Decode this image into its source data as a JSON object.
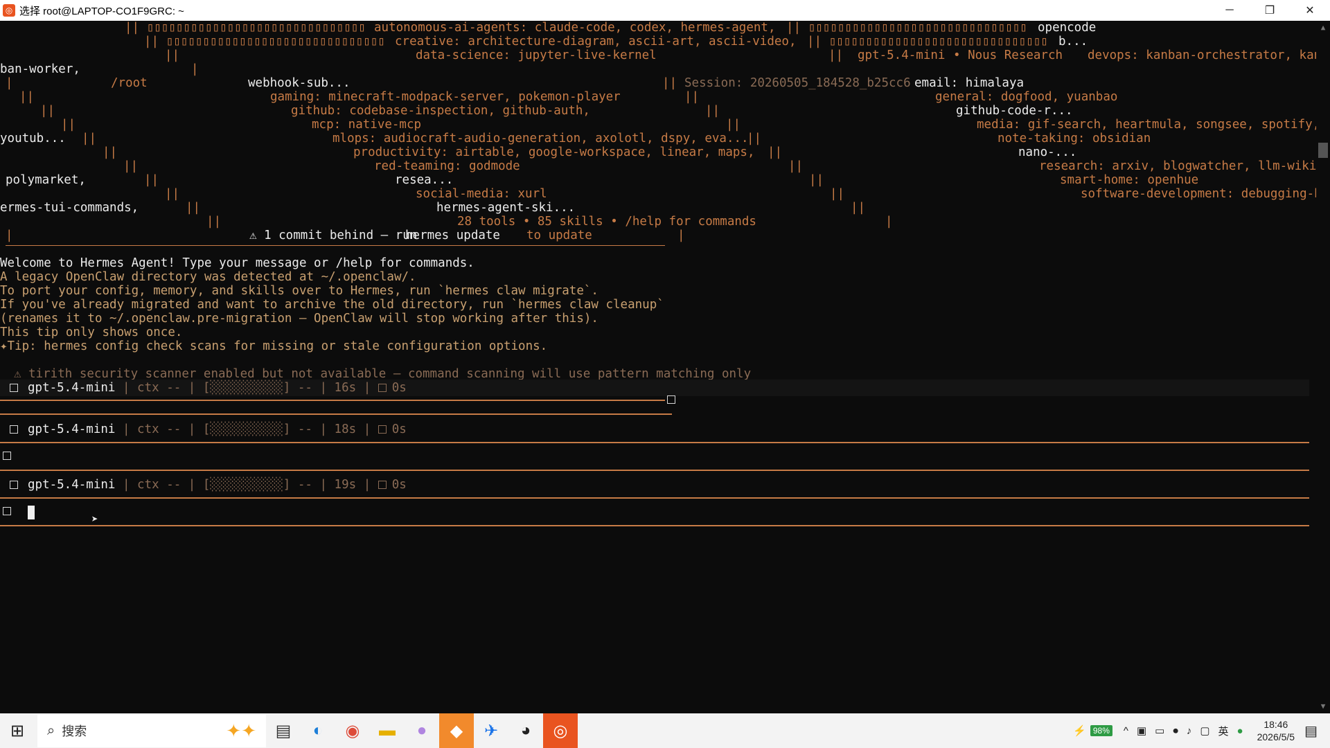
{
  "window": {
    "title": "选择 root@LAPTOP-CO1F9GRC: ~"
  },
  "banner": {
    "line1_skills": "autonomous-ai-agents: claude-code, codex, hermes-agent,",
    "line1_right": "opencode",
    "line2_skills": "creative: architecture-diagram, ascii-art, ascii-video,",
    "line2_right": "b...",
    "line3_skills": "data-science: jupyter-live-kernel",
    "line3_model": "gpt-5.4-mini",
    "line3_provider": "• Nous Research",
    "line3_devops": "devops: kanban-orchestrator, kan",
    "line4": "ban-worker,",
    "line5_cwd": "/root",
    "line5_mid": "webhook-sub...",
    "line5_session": "Session: 20260505_184528_b25cc6",
    "line5_email": "email: himalaya",
    "line6_gaming": "gaming: minecraft-modpack-server, pokemon-player",
    "line6_general": "general: dogfood, yuanbao",
    "line7_github": "github: codebase-inspection, github-auth,",
    "line7_right": "github-code-r...",
    "line8_mcp": "mcp: native-mcp",
    "line8_media": "media: gif-search, heartmula, songsee, spotify,",
    "line9_left": "youtub...",
    "line9_mlops": "mlops: audiocraft-audio-generation, axolotl, dspy, eva...",
    "line9_note": "note-taking: obsidian",
    "line10_prod": "productivity: airtable, google-workspace, linear, maps,",
    "line10_right": "nano-...",
    "line11_red": "red-teaming: godmode",
    "line11_research": "research: arxiv, blogwatcher, llm-wiki,",
    "line12_left": "polymarket,",
    "line12_mid": "resea...",
    "line12_smart": "smart-home: openhue",
    "line13_social": "social-media: xurl",
    "line13_soft": "software-development: debugging-h",
    "line14_left": "ermes-tui-commands,",
    "line14_mid": "hermes-agent-ski...",
    "line15_tools": "28 tools • 85 skills • /help for commands",
    "line16_warn": "⚠ 1 commit behind — run",
    "line16_cmd": "hermes update",
    "line16_tail": "to update"
  },
  "messages": {
    "welcome": "Welcome to Hermes Agent! Type your message or /help for commands.",
    "legacy1": "A legacy OpenClaw directory was detected at ~/.openclaw/.",
    "legacy2": "To port your config, memory, and skills over to Hermes, run `hermes claw migrate`.",
    "legacy3": "If you've already migrated and want to archive the old directory, run `hermes claw cleanup`",
    "legacy4": "(renames it to ~/.openclaw.pre-migration — OpenClaw will stop working after this).",
    "legacy5": "This tip only shows once.",
    "tip": "✦Tip: hermes config check scans for missing or stale configuration options.",
    "warning": "⚠ tirith security scanner enabled but not available — command scanning will use pattern matching only"
  },
  "status_bars": [
    {
      "model": "gpt-5.4-mini",
      "ctx": "ctx --",
      "bar": "[░░░░░░░░░░]",
      "dash": "--",
      "time": "16s",
      "elapsed": "0s"
    },
    {
      "model": "gpt-5.4-mini",
      "ctx": "ctx --",
      "bar": "[░░░░░░░░░░]",
      "dash": "--",
      "time": "18s",
      "elapsed": "0s"
    },
    {
      "model": "gpt-5.4-mini",
      "ctx": "ctx --",
      "bar": "[░░░░░░░░░░]",
      "dash": "--",
      "time": "19s",
      "elapsed": "0s"
    }
  ],
  "taskbar": {
    "search_placeholder": "搜索",
    "battery": "98%",
    "ime": "英",
    "time": "18:46",
    "date": "2026/5/5"
  },
  "colors": {
    "accent": "#c77b46",
    "background": "#0c0c0c"
  }
}
